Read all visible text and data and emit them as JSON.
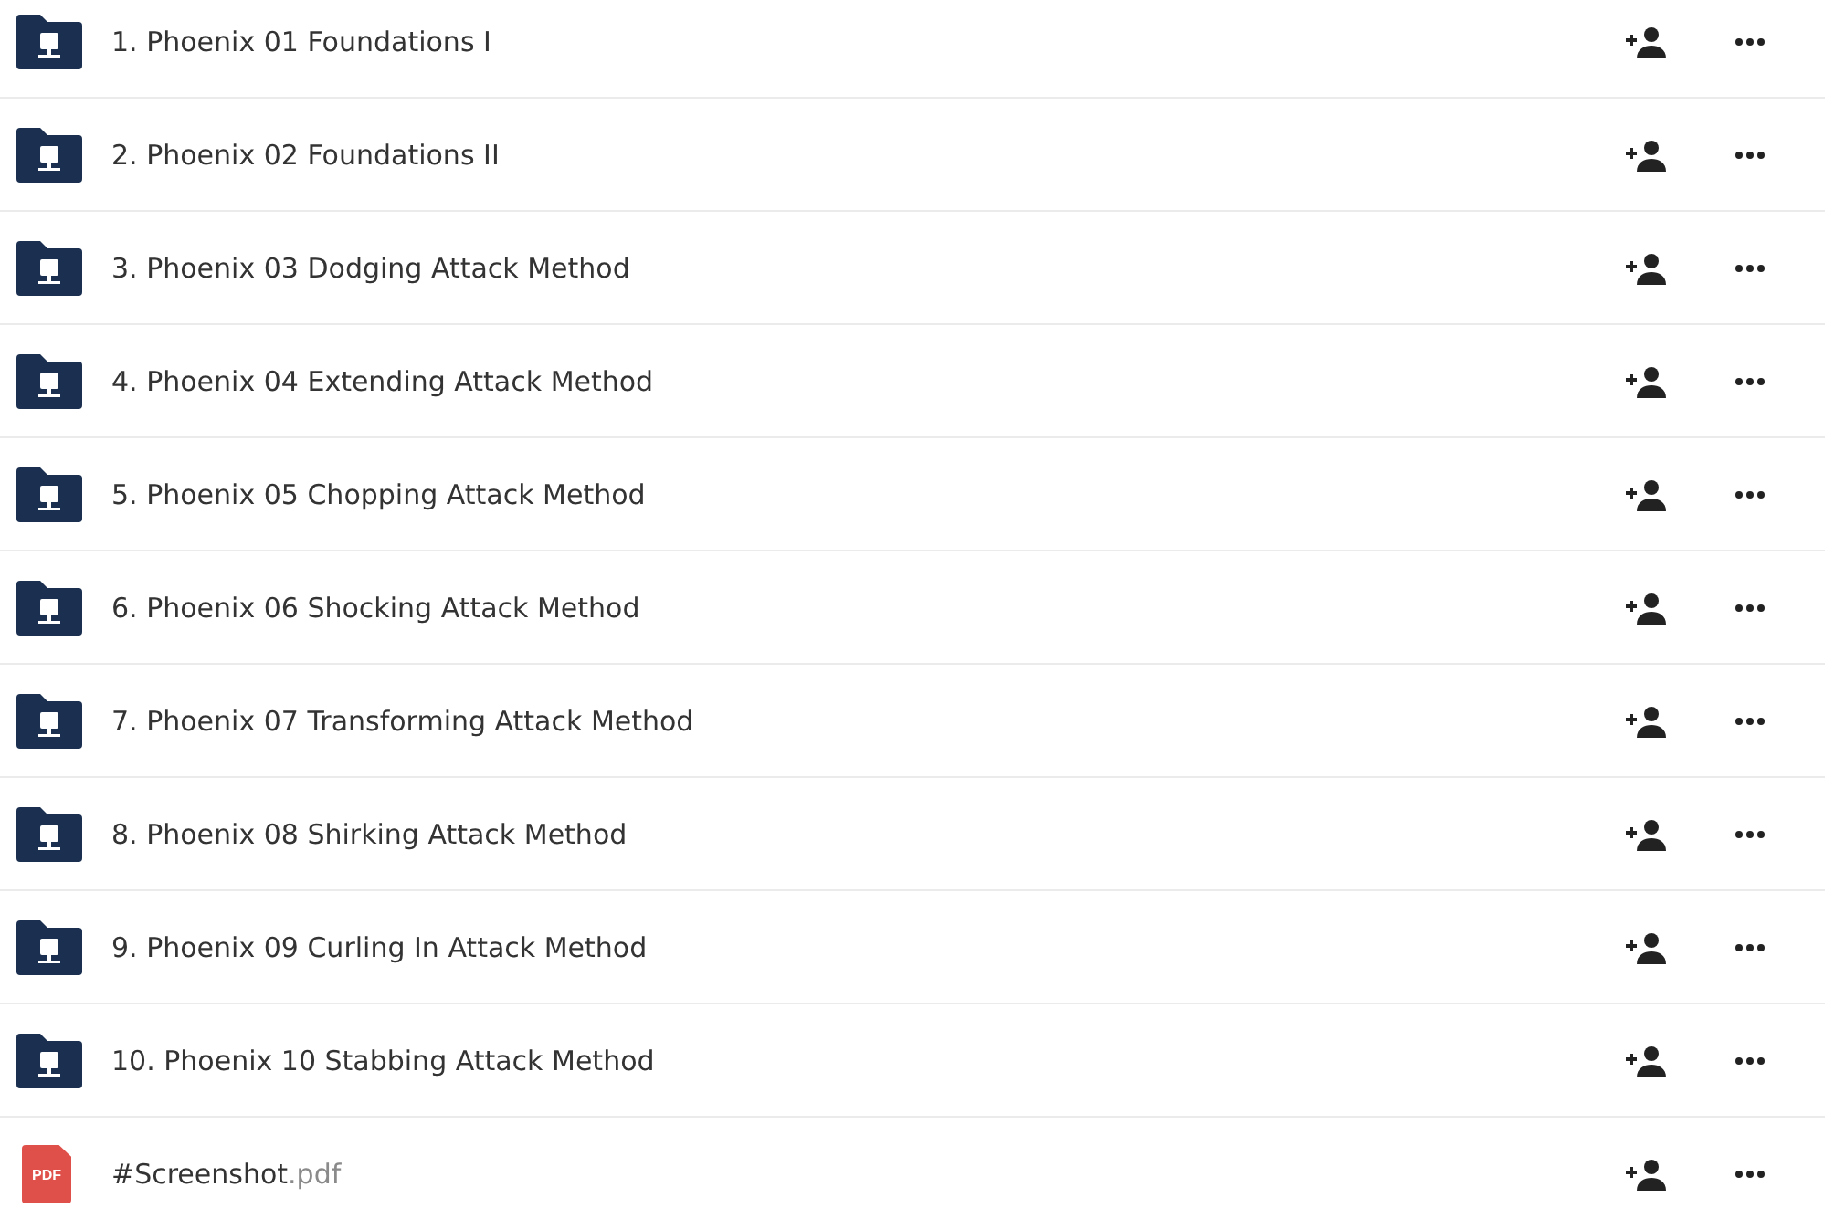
{
  "files": [
    {
      "kind": "folder",
      "name": "1. Phoenix 01 Foundations I"
    },
    {
      "kind": "folder",
      "name": "2. Phoenix 02 Foundations II"
    },
    {
      "kind": "folder",
      "name": "3. Phoenix 03 Dodging Attack Method"
    },
    {
      "kind": "folder",
      "name": "4. Phoenix 04 Extending Attack Method"
    },
    {
      "kind": "folder",
      "name": "5. Phoenix 05 Chopping Attack Method"
    },
    {
      "kind": "folder",
      "name": "6. Phoenix 06 Shocking Attack Method"
    },
    {
      "kind": "folder",
      "name": "7. Phoenix 07 Transforming Attack Method"
    },
    {
      "kind": "folder",
      "name": "8. Phoenix 08 Shirking Attack Method"
    },
    {
      "kind": "folder",
      "name": "9. Phoenix 09 Curling In Attack Method"
    },
    {
      "kind": "folder",
      "name": "10. Phoenix 10 Stabbing Attack Method"
    },
    {
      "kind": "pdf",
      "name": "#Screenshot",
      "extension": ".pdf",
      "icon_label": "PDF"
    }
  ]
}
